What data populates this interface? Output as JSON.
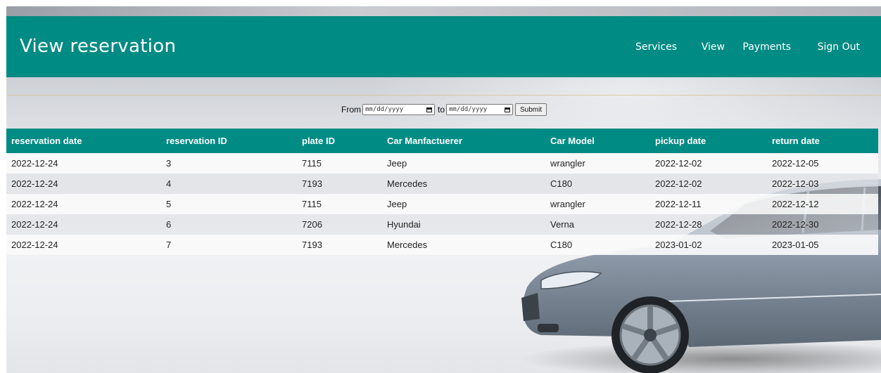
{
  "header": {
    "title": "View reservation",
    "nav": [
      "Services",
      "View",
      "Payments",
      "Sign Out"
    ]
  },
  "filter": {
    "from_label": "From",
    "from_placeholder": "mm/dd/yyyy",
    "to_label": "to",
    "to_placeholder": "mm/dd/yyyy",
    "submit_label": "Submit"
  },
  "table": {
    "columns": [
      "reservation date",
      "reservation ID",
      "plate ID",
      "Car Manfactuerer",
      "Car Model",
      "pickup date",
      "return date"
    ],
    "rows": [
      [
        "2022-12-24",
        "3",
        "7115",
        "Jeep",
        "wrangler",
        "2022-12-02",
        "2022-12-05"
      ],
      [
        "2022-12-24",
        "4",
        "7193",
        "Mercedes",
        "C180",
        "2022-12-02",
        "2022-12-03"
      ],
      [
        "2022-12-24",
        "5",
        "7115",
        "Jeep",
        "wrangler",
        "2022-12-11",
        "2022-12-12"
      ],
      [
        "2022-12-24",
        "6",
        "7206",
        "Hyundai",
        "Verna",
        "2022-12-28",
        "2022-12-30"
      ],
      [
        "2022-12-24",
        "7",
        "7193",
        "Mercedes",
        "C180",
        "2023-01-02",
        "2023-01-05"
      ]
    ]
  },
  "colors": {
    "header_bg": "#008b84",
    "header_text": "#ffffff"
  }
}
